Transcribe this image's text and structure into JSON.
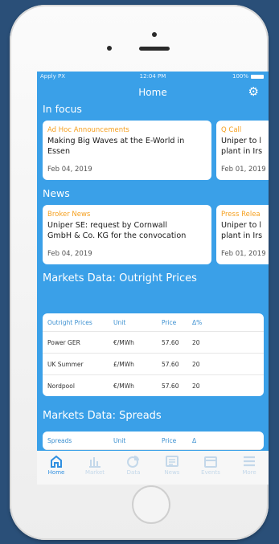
{
  "status_bar": {
    "carrier": "Apply PX",
    "time": "12:04 PM",
    "battery": "100%"
  },
  "nav": {
    "title": "Home"
  },
  "in_focus": {
    "title": "In focus",
    "cards": [
      {
        "category": "Ad Hoc Announcements",
        "headline": "Making Big Waves at the E-World in\nEssen",
        "date": "Feb 04, 2019"
      },
      {
        "category": "Q Call",
        "headline": "Uniper to l\nplant in Irs",
        "date": "Feb 01, 2019"
      }
    ]
  },
  "news": {
    "title": "News",
    "cards": [
      {
        "category": "Broker News",
        "headline": "Uniper SE: request by Cornwall\nGmbH & Co. KG for the convocation",
        "date": "Feb 04, 2019"
      },
      {
        "category": "Press Relea",
        "headline": "Uniper to l\nplant in Irs",
        "date": "Feb 01, 2019"
      }
    ]
  },
  "outright": {
    "title": "Markets Data: Outright Prices",
    "headers": [
      "Outright Prices",
      "Unit",
      "Price",
      "Δ%"
    ],
    "rows": [
      [
        "Power GER",
        "€/MWh",
        "57.60",
        "20"
      ],
      [
        "UK Summer",
        "£/MWh",
        "57.60",
        "20"
      ],
      [
        "Nordpool",
        "€/MWh",
        "57.60",
        "20"
      ]
    ]
  },
  "spreads": {
    "title": "Markets Data: Spreads",
    "headers": [
      "Spreads",
      "Unit",
      "Price",
      "Δ"
    ]
  },
  "tabs": [
    {
      "label": "Home",
      "icon": "home-icon",
      "active": true
    },
    {
      "label": "Market",
      "icon": "bar-chart-icon",
      "active": false
    },
    {
      "label": "Data",
      "icon": "pie-chart-icon",
      "active": false
    },
    {
      "label": "News",
      "icon": "newspaper-icon",
      "active": false
    },
    {
      "label": "Events",
      "icon": "calendar-icon",
      "active": false
    },
    {
      "label": "More",
      "icon": "menu-icon",
      "active": false
    }
  ],
  "colors": {
    "background": "#2a4f78",
    "screen": "#3aa0e8",
    "accent": "#2f8fe0",
    "category": "#f5a020"
  }
}
